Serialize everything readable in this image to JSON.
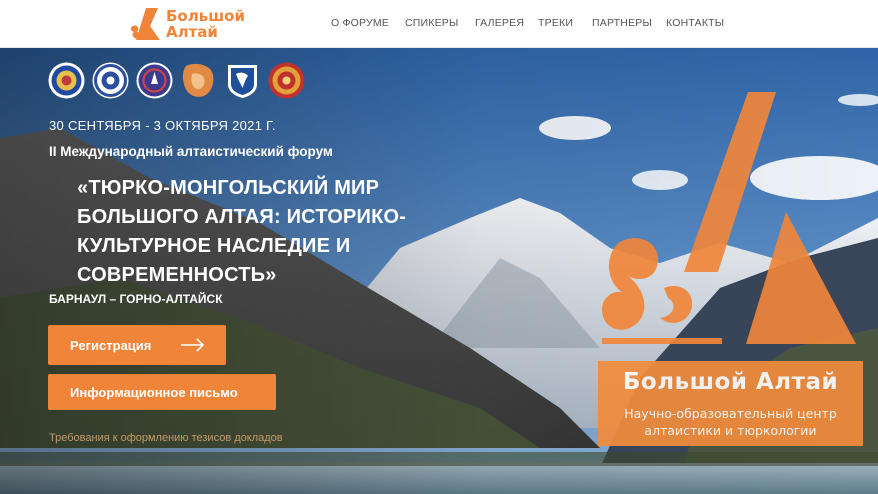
{
  "header": {
    "logo_line1": "Большой",
    "logo_line2": "Алтай",
    "nav": [
      "О ФОРУМЕ",
      "СПИКЕРЫ",
      "ГАЛЕРЕЯ",
      "ТРЕКИ",
      "ПАРТНЕРЫ",
      "КОНТАКТЫ"
    ]
  },
  "hero": {
    "partner_logos": [
      "partner-logo-1",
      "partner-logo-2",
      "partner-logo-3",
      "partner-logo-4",
      "partner-logo-5",
      "partner-logo-6"
    ],
    "date": "30 СЕНТЯБРЯ - 3 ОКТЯБРЯ 2021 Г.",
    "forum": "II Международный алтаистический форум",
    "title_lines": [
      "«ТЮРКО-МОНГОЛЬСКИЙ МИР",
      "БОЛЬШОГО АЛТАЯ: ИСТОРИКО-",
      "КУЛЬТУРНОЕ НАСЛЕДИЕ И",
      "СОВРЕМЕННОСТЬ»"
    ],
    "city": "БАРНАУЛ – ГОРНО-АЛТАЙСК",
    "register_button": "Регистрация",
    "info_button": "Информационное письмо",
    "requirements_link": "Требования к оформлению тезисов докладов"
  },
  "brand_card": {
    "name": "Большой Алтай",
    "subtitle_line1": "Научно-образовательный центр",
    "subtitle_line2": "алтаистики и тюркологии"
  },
  "colors": {
    "accent": "#f0853a",
    "sky": "#3f74b5",
    "white": "#ffffff"
  }
}
